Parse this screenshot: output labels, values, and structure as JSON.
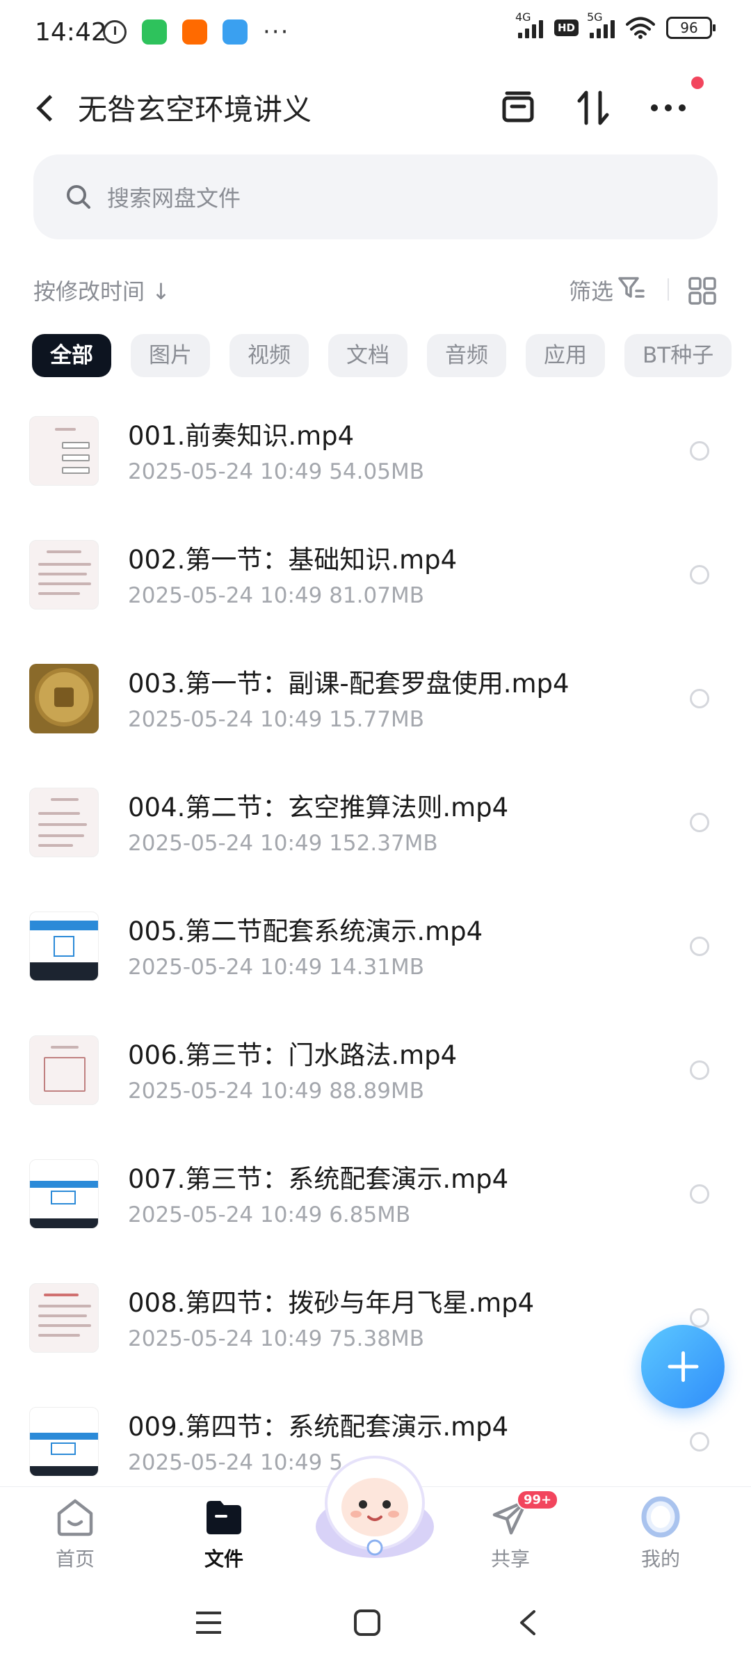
{
  "status_bar": {
    "time": "14:42",
    "battery": "96",
    "signal_1": "4G",
    "signal_2": "5G",
    "hd": "HD",
    "more": "···"
  },
  "header": {
    "title": "无咎玄空环境讲义"
  },
  "search": {
    "placeholder": "搜索网盘文件"
  },
  "sort": {
    "label": "按修改时间 ↓",
    "filter_label": "筛选"
  },
  "chips": [
    {
      "label": "全部",
      "active": true
    },
    {
      "label": "图片",
      "active": false
    },
    {
      "label": "视频",
      "active": false
    },
    {
      "label": "文档",
      "active": false
    },
    {
      "label": "音频",
      "active": false
    },
    {
      "label": "应用",
      "active": false
    },
    {
      "label": "BT种子",
      "active": false
    }
  ],
  "files": [
    {
      "name": "001.前奏知识.mp4",
      "meta": "2025-05-24  10:49   54.05MB",
      "thumb": "doc"
    },
    {
      "name": "002.第一节：基础知识.mp4",
      "meta": "2025-05-24  10:49   81.07MB",
      "thumb": "doc"
    },
    {
      "name": "003.第一节：副课-配套罗盘使用.mp4",
      "meta": "2025-05-24  10:49   15.77MB",
      "thumb": "coin"
    },
    {
      "name": "004.第二节：玄空推算法则.mp4",
      "meta": "2025-05-24  10:49   152.37MB",
      "thumb": "doc"
    },
    {
      "name": "005.第二节配套系统演示.mp4",
      "meta": "2025-05-24  10:49   14.31MB",
      "thumb": "screen"
    },
    {
      "name": "006.第三节：门水路法.mp4",
      "meta": "2025-05-24  10:49   88.89MB",
      "thumb": "doc"
    },
    {
      "name": "007.第三节：系统配套演示.mp4",
      "meta": "2025-05-24  10:49   6.85MB",
      "thumb": "screen"
    },
    {
      "name": "008.第四节：拨砂与年月飞星.mp4",
      "meta": "2025-05-24  10:49   75.38MB",
      "thumb": "doc"
    },
    {
      "name": "009.第四节：系统配套演示.mp4",
      "meta": "2025-05-24  10:49   5",
      "thumb": "screen"
    }
  ],
  "bottom_nav": {
    "home": "首页",
    "files": "文件",
    "share": "共享",
    "share_badge": "99+",
    "me": "我的"
  },
  "colors": {
    "accent": "#2f8dfa",
    "chip_active": "#0d1420",
    "badge": "#f2455d"
  }
}
